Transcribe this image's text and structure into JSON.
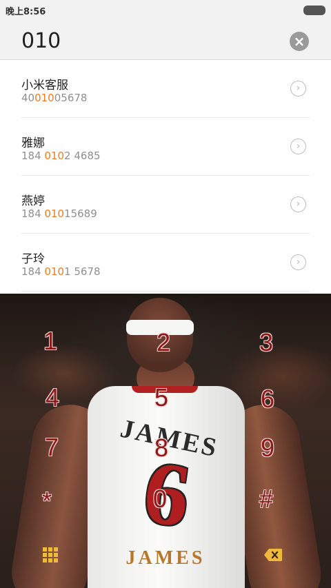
{
  "status_bar": {
    "time": "晚上8:56"
  },
  "search": {
    "query": "010",
    "clear_icon": "close-icon"
  },
  "results": [
    {
      "name": "小米客服",
      "number_prefix": "40",
      "number_match": "010",
      "number_suffix": "05678"
    },
    {
      "name": "雅娜",
      "number_prefix": "184 ",
      "number_match": "010",
      "number_suffix": "2 4685"
    },
    {
      "name": "燕婷",
      "number_prefix": "184 ",
      "number_match": "010",
      "number_suffix": "15689"
    },
    {
      "name": "子玲",
      "number_prefix": "184 ",
      "number_match": "010",
      "number_suffix": "1 5678"
    }
  ],
  "dialer": {
    "keys": [
      "1",
      "2",
      "3",
      "4",
      "5",
      "6",
      "7",
      "8",
      "9",
      "*",
      "0",
      "#"
    ],
    "brand": "JAMES",
    "jersey_name": "JAMES",
    "jersey_number": "6",
    "left_icon": "keypad-icon",
    "right_icon": "backspace-icon"
  }
}
